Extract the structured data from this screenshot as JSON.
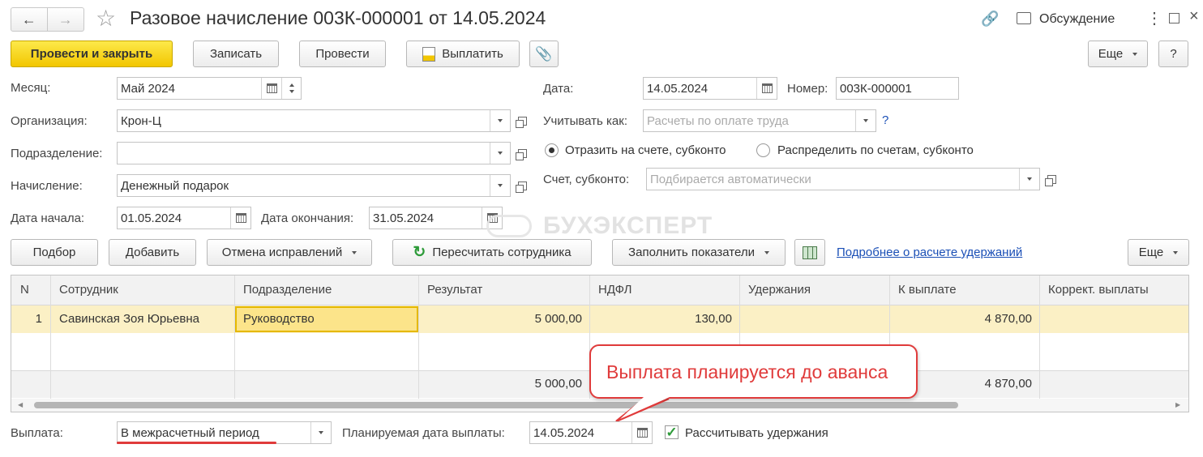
{
  "window": {
    "title": "Разовое начисление 003К-000001 от 14.05.2024",
    "discussion": "Обсуждение"
  },
  "toolbar": {
    "post_close": "Провести и закрыть",
    "save": "Записать",
    "post": "Провести",
    "pay": "Выплатить",
    "more": "Еще",
    "help": "?"
  },
  "form": {
    "month_label": "Месяц:",
    "month_value": "Май 2024",
    "org_label": "Организация:",
    "org_value": "Крон-Ц",
    "dept_label": "Подразделение:",
    "dept_value": "",
    "accrual_label": "Начисление:",
    "accrual_value": "Денежный подарок",
    "start_label": "Дата начала:",
    "start_value": "01.05.2024",
    "end_label": "Дата окончания:",
    "end_value": "31.05.2024",
    "date_label": "Дата:",
    "date_value": "14.05.2024",
    "number_label": "Номер:",
    "number_value": "003К-000001",
    "account_as_label": "Учитывать как:",
    "account_as_placeholder": "Расчеты по оплате труда",
    "account_as_help": "?",
    "radio1": "Отразить на счете, субконто",
    "radio2": "Распределить по счетам, субконто",
    "account_label": "Счет, субконто:",
    "account_placeholder": "Подбирается автоматически"
  },
  "watermark": "БУХЭКСПЕРТ",
  "table_toolbar": {
    "select": "Подбор",
    "add": "Добавить",
    "cancel_fix": "Отмена исправлений",
    "recalc": "Пересчитать сотрудника",
    "fill": "Заполнить показатели",
    "link": "Подробнее о расчете удержаний",
    "more": "Еще"
  },
  "table": {
    "headers": [
      "N",
      "Сотрудник",
      "Подразделение",
      "Результат",
      "НДФЛ",
      "Удержания",
      "К выплате",
      "Коррект. выплаты"
    ],
    "rows": [
      [
        "1",
        "Савинская Зоя Юрьевна",
        "Руководство",
        "5 000,00",
        "130,00",
        "",
        "4 870,00",
        ""
      ]
    ],
    "totals": {
      "result": "5 000,00",
      "pay": "4 870,00"
    }
  },
  "callout": "Выплата планируется до аванса",
  "footer": {
    "payout_label": "Выплата:",
    "payout_value": "В межрасчетный период",
    "plan_date_label": "Планируемая дата выплаты:",
    "plan_date_value": "14.05.2024",
    "calc_deductions": "Рассчитывать удержания"
  },
  "colors": {
    "accent": "#f2c600",
    "callout": "#e03b3b",
    "link": "#1a4fb6"
  }
}
